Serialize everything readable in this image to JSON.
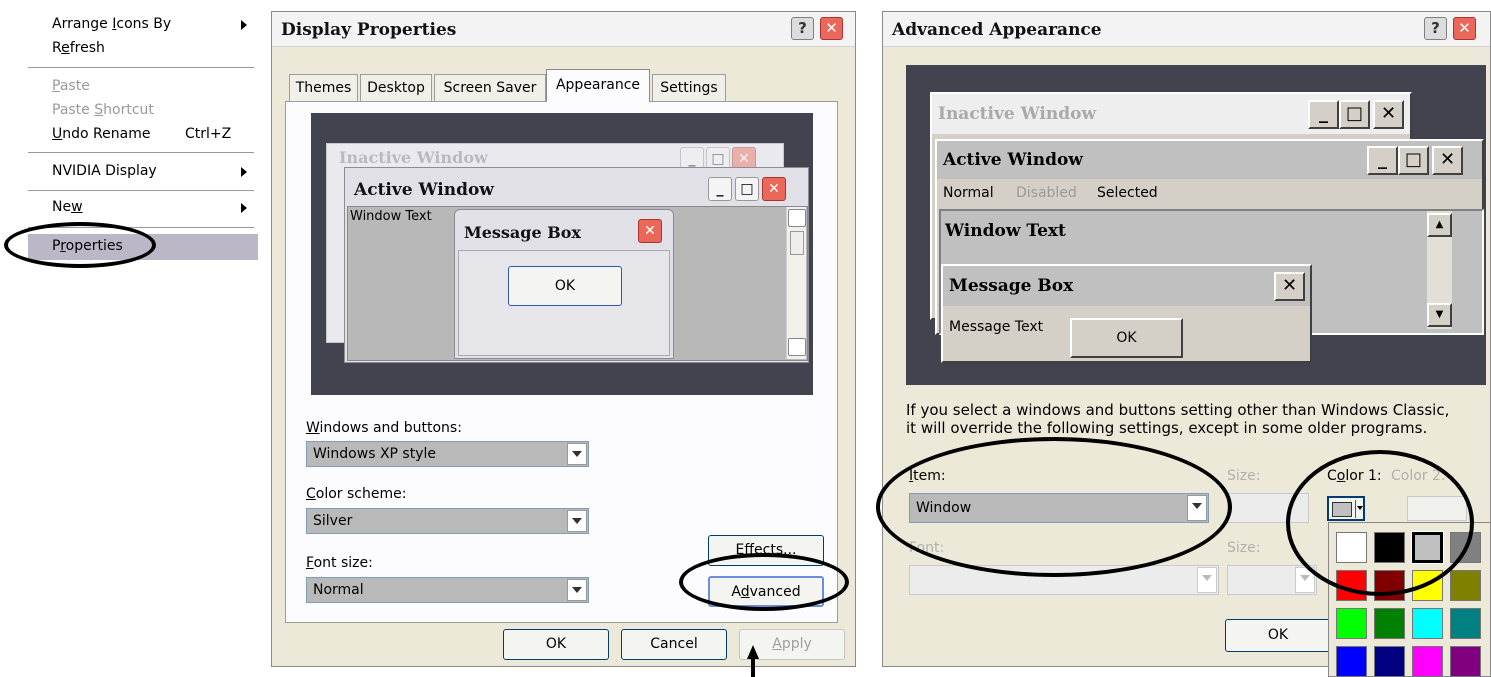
{
  "context_menu": {
    "arrange": "Arrange Icons By",
    "refresh": "Refresh",
    "paste": "Paste",
    "paste_shortcut": "Paste Shortcut",
    "undo_rename": "Undo Rename",
    "undo_shortcut": "Ctrl+Z",
    "nvidia": "NVIDIA Display",
    "new": "New",
    "properties": "Properties"
  },
  "display_properties": {
    "title": "Display Properties",
    "help": "?",
    "close": "✕",
    "tabs": [
      "Themes",
      "Desktop",
      "Screen Saver",
      "Appearance",
      "Settings"
    ],
    "preview": {
      "inactive_title": "Inactive Window",
      "active_title": "Active Window",
      "window_text": "Window Text",
      "message_box_title": "Message Box",
      "ok": "OK"
    },
    "windows_and_buttons_label": "Windows and buttons:",
    "windows_and_buttons_value": "Windows XP style",
    "color_scheme_label": "Color scheme:",
    "color_scheme_value": "Silver",
    "font_size_label": "Font size:",
    "font_size_value": "Normal",
    "effects": "Effects...",
    "advanced": "Advanced",
    "ok": "OK",
    "cancel": "Cancel",
    "apply": "Apply"
  },
  "advanced_appearance": {
    "title": "Advanced Appearance",
    "help": "?",
    "close": "✕",
    "preview": {
      "inactive_title": "Inactive Window",
      "active_title": "Active Window",
      "menu_normal": "Normal",
      "menu_disabled": "Disabled",
      "menu_selected": "Selected",
      "window_text": "Window Text",
      "message_box_title": "Message Box",
      "message_text": "Message Text",
      "ok": "OK"
    },
    "info_line1": "If you select a windows and buttons setting other than Windows Classic,",
    "info_line2": "it will override the following settings, except in some older programs.",
    "item_label": "Item:",
    "item_value": "Window",
    "size_label": "Size:",
    "color1_label": "Color 1:",
    "color2_label": "Color 2:",
    "font_label": "Font:",
    "font_size_label": "Size:",
    "ok": "OK"
  },
  "colors": {
    "palette": [
      "#ffffff",
      "#000000",
      "#c0c0c0",
      "#808080",
      "#ff0000",
      "#800000",
      "#ffff00",
      "#808000",
      "#00ff00",
      "#008000",
      "#00ffff",
      "#008080",
      "#0000ff",
      "#000080",
      "#ff00ff",
      "#800080"
    ],
    "selected_swatch": 2
  }
}
